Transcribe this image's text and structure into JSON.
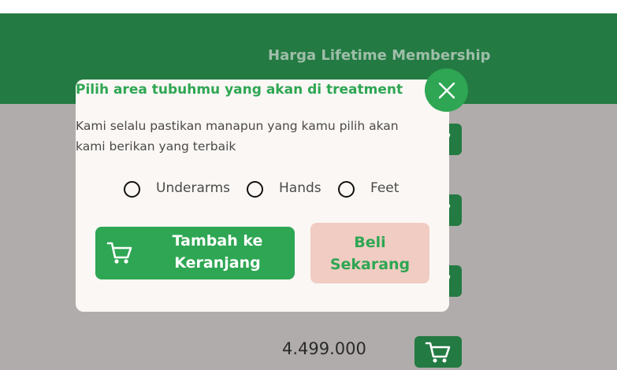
{
  "header": {
    "title": "Harga Lifetime Membership"
  },
  "background": {
    "price": "4.499.000"
  },
  "modal": {
    "title": "Pilih area tubuhmu yang akan di treatment",
    "description_line1": "Kami selalu pastikan manapun yang kamu pilih akan",
    "description_line2": "kami berikan yang terbaik",
    "options": [
      {
        "label": "Underarms",
        "selected": false
      },
      {
        "label": "Hands",
        "selected": false
      },
      {
        "label": "Feet",
        "selected": false
      }
    ],
    "add_button": {
      "line1": "Tambah ke",
      "line2": "Keranjang",
      "icon": "cart-icon"
    },
    "buy_button": {
      "line1": "Beli",
      "line2": "Sekarang"
    },
    "close_icon": "close-icon"
  },
  "colors": {
    "brand_green": "#2ea653",
    "header_green": "#237a42",
    "overlay_gray": "#b0acab",
    "buy_button_bg": "#f0ccc2",
    "modal_bg": "#fbf7f4"
  }
}
